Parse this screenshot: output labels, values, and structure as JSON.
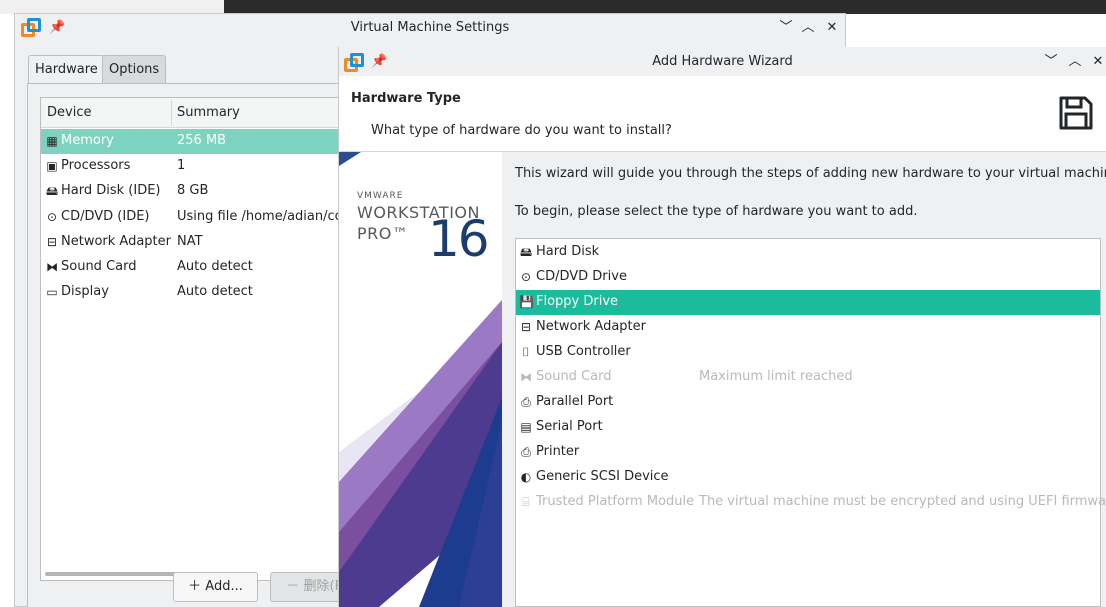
{
  "vm_settings": {
    "title": "Virtual Machine Settings",
    "tabs": [
      "Hardware",
      "Options"
    ],
    "table": {
      "headers": [
        "Device",
        "Summary"
      ],
      "rows": [
        {
          "icon": "memory-icon",
          "device": "Memory",
          "summary": "256 MB"
        },
        {
          "icon": "processor-icon",
          "device": "Processors",
          "summary": "1"
        },
        {
          "icon": "hard-disk-icon",
          "device": "Hard Disk (IDE)",
          "summary": "8 GB"
        },
        {
          "icon": "cd-dvd-icon",
          "device": "CD/DVD (IDE)",
          "summary": "Using file /home/adian/coc"
        },
        {
          "icon": "network-adapter-icon",
          "device": "Network Adapter",
          "summary": "NAT"
        },
        {
          "icon": "sound-card-icon",
          "device": "Sound Card",
          "summary": "Auto detect"
        },
        {
          "icon": "display-icon",
          "device": "Display",
          "summary": "Auto detect"
        }
      ]
    },
    "buttons": {
      "add": "Add...",
      "remove": "删除(R"
    },
    "selected_row_color": "#7ed3c0"
  },
  "wizard": {
    "title": "Add Hardware Wizard",
    "header_title": "Hardware Type",
    "header_subtitle": "What type of hardware do you want to install?",
    "brand": {
      "vendor": "VMWARE",
      "product": "WORKSTATION",
      "edition": "PRO™",
      "version": "16"
    },
    "intro": "This wizard will guide you through the steps of adding new hardware to your virtual machine.",
    "instruction": "To begin, please select the type of hardware you want to add.",
    "hardware_types": [
      {
        "icon": "hard-disk-icon",
        "name": "Hard Disk",
        "note": "",
        "state": "normal"
      },
      {
        "icon": "cd-dvd-icon",
        "name": "CD/DVD Drive",
        "note": "",
        "state": "normal"
      },
      {
        "icon": "floppy-icon",
        "name": "Floppy Drive",
        "note": "",
        "state": "selected"
      },
      {
        "icon": "network-adapter-icon",
        "name": "Network Adapter",
        "note": "",
        "state": "normal"
      },
      {
        "icon": "usb-icon",
        "name": "USB Controller",
        "note": "",
        "state": "normal"
      },
      {
        "icon": "sound-card-icon",
        "name": "Sound Card",
        "note": "Maximum limit reached",
        "state": "disabled"
      },
      {
        "icon": "parallel-port-icon",
        "name": "Parallel Port",
        "note": "",
        "state": "normal"
      },
      {
        "icon": "serial-port-icon",
        "name": "Serial Port",
        "note": "",
        "state": "normal"
      },
      {
        "icon": "printer-icon",
        "name": "Printer",
        "note": "",
        "state": "normal"
      },
      {
        "icon": "scsi-icon",
        "name": "Generic SCSI Device",
        "note": "",
        "state": "normal"
      },
      {
        "icon": "tpm-icon",
        "name": "Trusted Platform Module",
        "note": "The virtual machine must be encrypted and using UEFI firmware.",
        "state": "disabled"
      }
    ],
    "selected_row_color": "#1abc9c"
  }
}
